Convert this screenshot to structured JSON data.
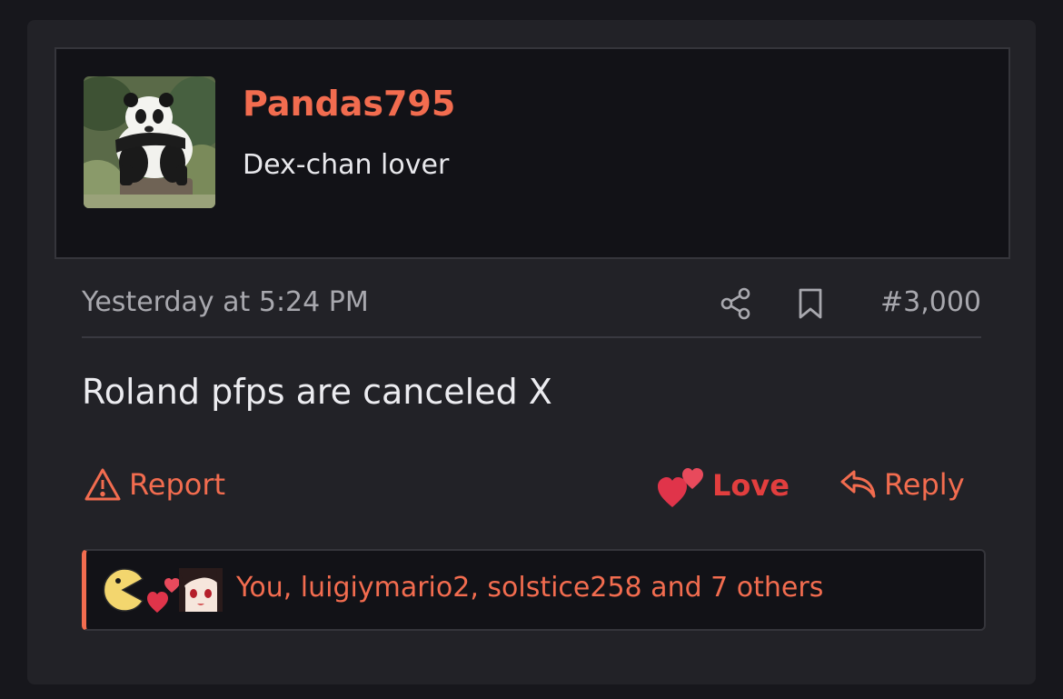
{
  "post": {
    "user": {
      "username": "Pandas795",
      "title": "Dex-chan lover"
    },
    "meta": {
      "timestamp": "Yesterday at 5:24 PM",
      "post_number": "#3,000"
    },
    "message": "Roland pfps are canceled X",
    "actions": {
      "report_label": "Report",
      "love_label": "Love",
      "reply_label": "Reply"
    },
    "reactions": {
      "summary": "You, luigiymario2, solstice258 and 7 others"
    }
  },
  "colors": {
    "accent": "#f26c4f",
    "love": "#e23e3e",
    "background": "#17171c",
    "panel": "#222227",
    "card": "#121217"
  }
}
